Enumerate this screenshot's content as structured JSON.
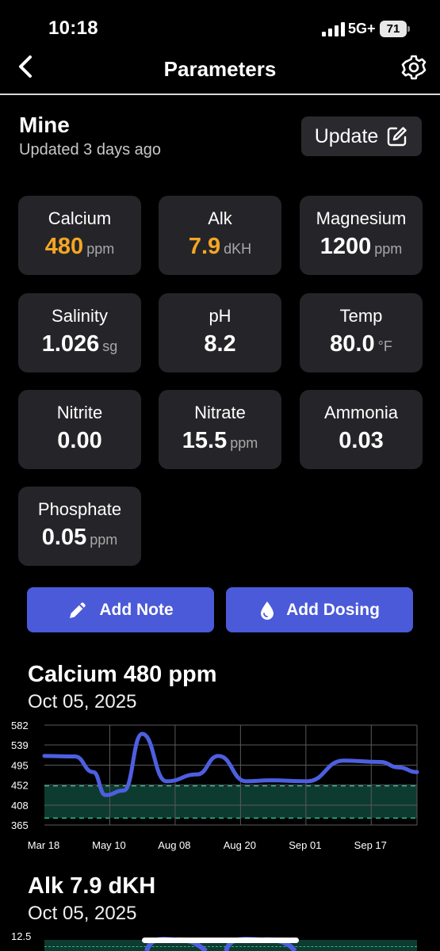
{
  "status_bar": {
    "time": "10:18",
    "network": "5G+",
    "battery": "71"
  },
  "nav": {
    "title": "Parameters",
    "back_icon": "chevron-left-icon",
    "settings_icon": "gear-icon"
  },
  "header": {
    "tank_name": "Mine",
    "updated": "Updated 3 days ago",
    "update_label": "Update",
    "update_icon": "edit-icon"
  },
  "colors": {
    "accent_orange": "#f5a623",
    "button_blue": "#4a5ad8",
    "line_blue": "#4d5fe0",
    "range_green": "#1f8a6a",
    "card_bg": "#252529"
  },
  "parameters": [
    {
      "name": "Calcium",
      "value": "480",
      "unit": "ppm",
      "highlight": true
    },
    {
      "name": "Alk",
      "value": "7.9",
      "unit": "dKH",
      "highlight": true
    },
    {
      "name": "Magnesium",
      "value": "1200",
      "unit": "ppm",
      "highlight": false
    },
    {
      "name": "Salinity",
      "value": "1.026",
      "unit": "sg",
      "highlight": false
    },
    {
      "name": "pH",
      "value": "8.2",
      "unit": "",
      "highlight": false
    },
    {
      "name": "Temp",
      "value": "80.0",
      "unit": "°F",
      "highlight": false
    },
    {
      "name": "Nitrite",
      "value": "0.00",
      "unit": "",
      "highlight": false
    },
    {
      "name": "Nitrate",
      "value": "15.5",
      "unit": "ppm",
      "highlight": false
    },
    {
      "name": "Ammonia",
      "value": "0.03",
      "unit": "",
      "highlight": false
    },
    {
      "name": "Phosphate",
      "value": "0.05",
      "unit": "ppm",
      "highlight": false
    }
  ],
  "actions": {
    "add_note": "Add Note",
    "add_note_icon": "pencil-icon",
    "add_dosing": "Add Dosing",
    "add_dosing_icon": "drop-icon"
  },
  "charts": {
    "calcium": {
      "title": "Calcium 480 ppm",
      "date": "Oct 05, 2025"
    },
    "alk": {
      "title": "Alk 7.9 dKH",
      "date": "Oct 05, 2025",
      "y_top_label": "12.5"
    }
  },
  "chart_data": [
    {
      "type": "line",
      "title": "Calcium 480 ppm",
      "x_tick_labels": [
        "Mar 18",
        "May 10",
        "Aug 08",
        "Aug 20",
        "Sep 01",
        "Sep 17"
      ],
      "y_tick_labels": [
        "582",
        "539",
        "495",
        "452",
        "408",
        "365"
      ],
      "ylim": [
        365,
        582
      ],
      "target_range": [
        380,
        450
      ],
      "grid": true,
      "series": [
        {
          "values": [
            [
              0,
              515
            ],
            [
              0.5,
              514
            ],
            [
              0.8,
              480
            ],
            [
              1.0,
              430
            ],
            [
              1.3,
              440
            ],
            [
              1.6,
              563
            ],
            [
              2.0,
              460
            ],
            [
              2.5,
              475
            ],
            [
              2.85,
              515
            ],
            [
              3.3,
              460
            ],
            [
              3.7,
              462
            ],
            [
              4.3,
              460
            ],
            [
              4.9,
              505
            ],
            [
              5.5,
              502
            ],
            [
              5.8,
              490
            ],
            [
              6.1,
              480
            ]
          ]
        }
      ]
    }
  ]
}
